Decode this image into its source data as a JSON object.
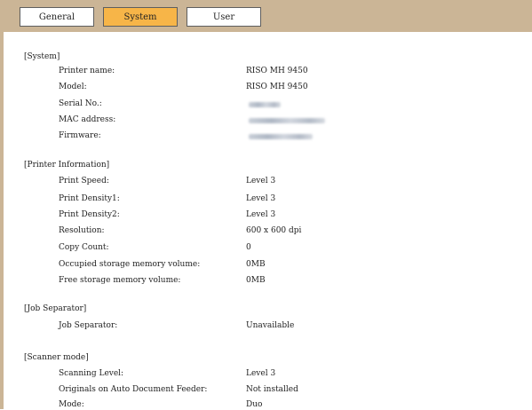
{
  "tabs": [
    {
      "label": "General"
    },
    {
      "label": "System"
    },
    {
      "label": "User"
    }
  ],
  "sections": {
    "system": {
      "title": "[System]",
      "rows": [
        {
          "label": "Printer name:",
          "value": "RISO MH 9450"
        },
        {
          "label": "Model:",
          "value": "RISO MH 9450"
        },
        {
          "label": "Serial No.:",
          "value": ""
        },
        {
          "label": "MAC address:",
          "value": ""
        },
        {
          "label": "Firmware:",
          "value": ""
        }
      ]
    },
    "printer_info": {
      "title": "[Printer Information]",
      "rows": [
        {
          "label": "Print Speed:",
          "value": "Level 3"
        },
        {
          "label": "Print Density1:",
          "value": "Level 3"
        },
        {
          "label": "Print Density2:",
          "value": "Level 3"
        },
        {
          "label": "Resolution:",
          "value": "600 x 600 dpi"
        },
        {
          "label": "Copy Count:",
          "value": "0"
        },
        {
          "label": "Occupied storage memory volume:",
          "value": "0MB"
        },
        {
          "label": "Free storage memory volume:",
          "value": "0MB"
        }
      ]
    },
    "job_separator": {
      "title": "[Job Separator]",
      "rows": [
        {
          "label": "Job Separator:",
          "value": "Unavailable"
        }
      ]
    },
    "scanner_mode": {
      "title": "[Scanner mode]",
      "rows": [
        {
          "label": "Scanning Level:",
          "value": "Level 3"
        },
        {
          "label": "Originals on Auto Document Feeder:",
          "value": "Not installed"
        },
        {
          "label": "Mode:",
          "value": "Duo"
        }
      ]
    }
  },
  "colors": {
    "tab_bar": "#cbb596",
    "active_tab": "#f7b548"
  }
}
